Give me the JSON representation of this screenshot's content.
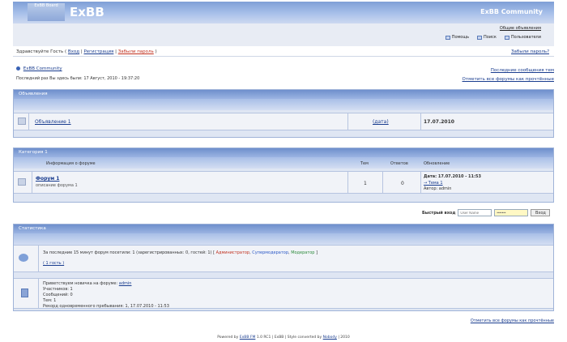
{
  "header": {
    "logo_box": "ExBB Board",
    "logo_text": "ExBB",
    "community": "ExBB Community"
  },
  "subbar": {
    "news": "Общие объявления",
    "nav": [
      {
        "label": "Помощь",
        "icon": "help-icon"
      },
      {
        "label": "Поиск",
        "icon": "search-icon"
      },
      {
        "label": "Пользователи",
        "icon": "users-icon"
      }
    ]
  },
  "userbar": {
    "greeting": "Здравствуйте Гость (",
    "login": "Вход",
    "sep1": "|",
    "register": "Регистрация",
    "sep2": "|",
    "lost_pass": "Забыли пароль",
    "close": ")",
    "right": "Забыли пароль?"
  },
  "crumbs": {
    "title": "ExBB Community",
    "last_visit": "Последний раз Вы здесь были: 17 Август, 2010 - 19:37:20"
  },
  "right_links": {
    "all_posts": "Последние сообщения тем",
    "mark_read": "Отметить все форумы как прочтённые"
  },
  "announce": {
    "title": "Объявления",
    "item": "Объявление 1",
    "date_link": "(дата)",
    "date": "17.07.2010"
  },
  "category": {
    "title": "Категория 1",
    "col_info": "Информация о форуме",
    "col_topics": "Тем",
    "col_posts": "Ответов",
    "col_updated": "Обновление",
    "forum_name": "Форум 1",
    "forum_desc": "описание форума 1",
    "topics": "1",
    "posts": "0",
    "updated_date": "Дата: 17.07.2010 - 11:53",
    "updated_topic": "→ Тема 1",
    "updated_author": "Автор: admin"
  },
  "quick_login": {
    "label": "Быстрый вход",
    "user_placeholder": "User Name",
    "pass_value": "•••••••",
    "button": "Вход"
  },
  "stats": {
    "title": "Статистика",
    "online_text": "За последние 15 минут форум посетили: 1 (зарегистрированных: 0, гостей: 1)",
    "legend_open": "[",
    "legend_admin": "Администратор",
    "legend_sep1": ",",
    "legend_smod": "Супермодератор",
    "legend_sep2": ",",
    "legend_mod": "Модератор",
    "legend_close": "]",
    "online_user": "( 1 гость )",
    "new_member_label": "Приветствуем новичка на форуме:",
    "new_member": "admin",
    "users_line": "Участников: 1",
    "posts_line": "Сообщений: 0",
    "topics_line": "Тем: 1",
    "record_line": "Рекорд одновременного пребывания: 1, 17.07.2010 - 11:53"
  },
  "bottom_link": "Отметить все форумы как прочтённые",
  "footer": {
    "powered": "Powered by",
    "exbb": "ExBB FM",
    "ver": "1.0 RC1",
    "rest": "| ExBB | Style converted by",
    "author": "Nobody",
    "end": "| 2010"
  }
}
